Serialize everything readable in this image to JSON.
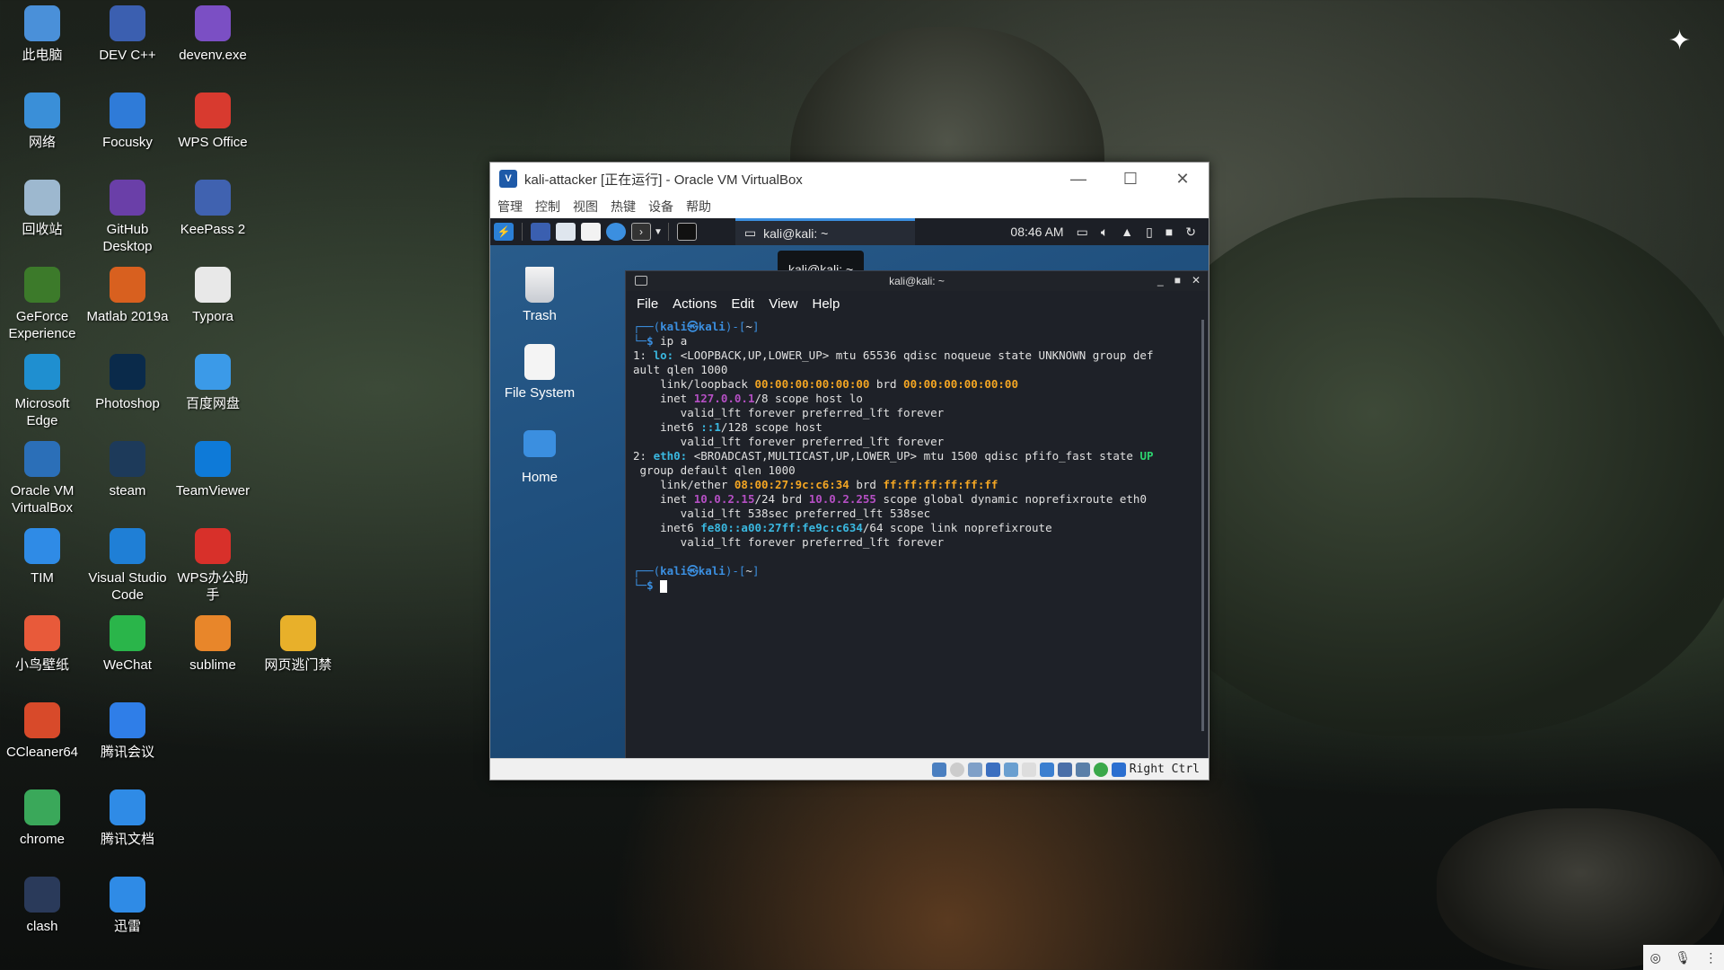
{
  "desktop": {
    "icons": [
      {
        "label": "此电脑",
        "icon": "computer-icon",
        "color": "#4a90d9"
      },
      {
        "label": "DEV C++",
        "icon": "devcpp-icon",
        "color": "#3b5fb0"
      },
      {
        "label": "devenv.exe",
        "icon": "visual-studio-icon",
        "color": "#7b4fc4"
      },
      {
        "label": "网络",
        "icon": "network-icon",
        "color": "#3a8fd8"
      },
      {
        "label": "Focusky",
        "icon": "focusky-icon",
        "color": "#2f7bd8"
      },
      {
        "label": "WPS Office",
        "icon": "wps-icon",
        "color": "#d83a2f"
      },
      {
        "label": "回收站",
        "icon": "recycle-bin-icon",
        "color": "#9db8cf"
      },
      {
        "label": "GitHub Desktop",
        "icon": "github-icon",
        "color": "#6a3fa8"
      },
      {
        "label": "KeePass 2",
        "icon": "keepass-icon",
        "color": "#4062b0"
      },
      {
        "label": "GeForce Experience",
        "icon": "geforce-icon",
        "color": "#3c7a2a"
      },
      {
        "label": "Matlab 2019a",
        "icon": "matlab-icon",
        "color": "#d8601f"
      },
      {
        "label": "Typora",
        "icon": "typora-icon",
        "color": "#e8e8e8"
      },
      {
        "label": "Microsoft Edge",
        "icon": "edge-icon",
        "color": "#1f8fd0"
      },
      {
        "label": "Photoshop",
        "icon": "photoshop-icon",
        "color": "#0a2a4a"
      },
      {
        "label": "百度网盘",
        "icon": "baidu-pan-icon",
        "color": "#3b9ae8"
      },
      {
        "label": "Oracle VM VirtualBox",
        "icon": "virtualbox-icon",
        "color": "#2b6fb8"
      },
      {
        "label": "steam",
        "icon": "steam-icon",
        "color": "#1d3a5a"
      },
      {
        "label": "TeamViewer",
        "icon": "teamviewer-icon",
        "color": "#0e7ad8"
      },
      {
        "label": "TIM",
        "icon": "tim-icon",
        "color": "#2f8be6"
      },
      {
        "label": "Visual Studio Code",
        "icon": "vscode-icon",
        "color": "#1f7fd6"
      },
      {
        "label": "WPS办公助手",
        "icon": "wps-assistant-icon",
        "color": "#d8302a"
      },
      {
        "label": "小鸟壁纸",
        "icon": "bird-wallpaper-icon",
        "color": "#e85a3a"
      },
      {
        "label": "WeChat",
        "icon": "wechat-icon",
        "color": "#2ab54a"
      },
      {
        "label": "sublime",
        "icon": "sublime-icon",
        "color": "#e8862a"
      },
      {
        "label": "网页逃门禁",
        "icon": "web-gate-icon",
        "color": "#e8b02a"
      },
      {
        "label": "CCleaner64",
        "icon": "ccleaner-icon",
        "color": "#d84a2a"
      },
      {
        "label": "腾讯会议",
        "icon": "tencent-meeting-icon",
        "color": "#2f7ee8"
      },
      {
        "label": "chrome",
        "icon": "chrome-icon",
        "color": "#3aa85a"
      },
      {
        "label": "腾讯文档",
        "icon": "tencent-docs-icon",
        "color": "#2f8be6"
      },
      {
        "label": "clash",
        "icon": "clash-icon",
        "color": "#2a3a5a"
      },
      {
        "label": "迅雷",
        "icon": "xunlei-icon",
        "color": "#2f8be6"
      }
    ]
  },
  "vbox": {
    "title": "kali-attacker [正在运行] - Oracle VM VirtualBox",
    "menu": [
      "管理",
      "控制",
      "视图",
      "热键",
      "设备",
      "帮助"
    ],
    "status_host_key": "Right Ctrl"
  },
  "kali": {
    "task_label": "kali@kali: ~",
    "clock": "08:46 AM",
    "tooltip": "kali@kali: ~",
    "desktop_icons": [
      {
        "label": "Trash"
      },
      {
        "label": "File System"
      },
      {
        "label": "Home"
      }
    ]
  },
  "terminal": {
    "title": "kali@kali: ~",
    "menu": [
      "File",
      "Actions",
      "Edit",
      "View",
      "Help"
    ],
    "prompt_user": "kali㉿kali",
    "prompt_dir": "~",
    "command": "ip a",
    "lines": {
      "l1a": "1: ",
      "l1b": "lo: ",
      "l1c": "<LOOPBACK,UP,LOWER_UP> mtu 65536 qdisc noqueue state UNKNOWN group def",
      "l2": "ault qlen 1000",
      "l3a": "    link/loopback ",
      "l3b": "00:00:00:00:00:00",
      "l3c": " brd ",
      "l3d": "00:00:00:00:00:00",
      "l4a": "    inet ",
      "l4b": "127.0.0.1",
      "l4c": "/8 scope host lo",
      "l5": "       valid_lft forever preferred_lft forever",
      "l6a": "    inet6 ",
      "l6b": "::1",
      "l6c": "/128 scope host",
      "l7": "       valid_lft forever preferred_lft forever",
      "l8a": "2: ",
      "l8b": "eth0: ",
      "l8c": "<BROADCAST,MULTICAST,UP,LOWER_UP> mtu 1500 qdisc pfifo_fast state ",
      "l8d": "UP",
      "l9": " group default qlen 1000",
      "l10a": "    link/ether ",
      "l10b": "08:00:27:9c:c6:34",
      "l10c": " brd ",
      "l10d": "ff:ff:ff:ff:ff:ff",
      "l11a": "    inet ",
      "l11b": "10.0.2.15",
      "l11c": "/24 brd ",
      "l11d": "10.0.2.255",
      "l11e": " scope global dynamic noprefixroute eth0",
      "l12": "       valid_lft 538sec preferred_lft 538sec",
      "l13a": "    inet6 ",
      "l13b": "fe80::a00:27ff:fe9c:c634",
      "l13c": "/64 scope link noprefixroute",
      "l14": "       valid_lft forever preferred_lft forever"
    }
  }
}
